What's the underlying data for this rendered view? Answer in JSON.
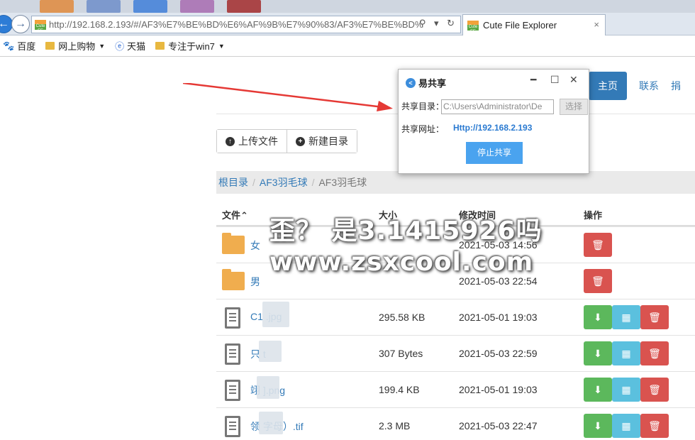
{
  "browser": {
    "url": "http://192.168.2.193/#/AF3%E7%BE%BD%E6%AF%9B%E7%90%83/AF3%E7%BE%BD%E6%",
    "tab_title": "Cute File Explorer",
    "tab_close": "×",
    "favicon_text": "Cute FE",
    "back_glyph": "←",
    "forward_glyph": "→",
    "addr_icons": "⚲ ▾ ↻",
    "bookmarks": [
      {
        "label": "百度",
        "icon": "baidu-icon"
      },
      {
        "label": "网上购物",
        "icon": "folder-icon",
        "dropdown": true
      },
      {
        "label": "天猫",
        "icon": "ie-page-icon"
      },
      {
        "label": "专注于win7",
        "icon": "folder-icon",
        "dropdown": true
      }
    ]
  },
  "nav": {
    "home": "主页",
    "contact": "联系",
    "donate": "捐"
  },
  "toolbar": {
    "upload": "上传文件",
    "new_dir": "新建目录"
  },
  "breadcrumb": {
    "root": "根目录",
    "level1": "AF3羽毛球",
    "current": "AF3羽毛球",
    "sep": "/"
  },
  "table": {
    "headers": {
      "file": "文件",
      "sort_arrow": "⌃",
      "size": "大小",
      "mtime": "修改时间",
      "ops": "操作"
    },
    "rows": [
      {
        "type": "folder",
        "name": "女",
        "size": "",
        "mtime": "2021-05-03 14:56"
      },
      {
        "type": "folder",
        "name": "男",
        "size": "",
        "mtime": "2021-05-03 22:54"
      },
      {
        "type": "file",
        "name": "C1 .jpg",
        "size": "295.58 KB",
        "mtime": "2021-05-01 19:03"
      },
      {
        "type": "file",
        "name": "只 t",
        "size": "307 Bytes",
        "mtime": "2021-05-03 22:59"
      },
      {
        "type": "file",
        "name": "翊 ].png",
        "size": "199.4 KB",
        "mtime": "2021-05-01 19:03"
      },
      {
        "type": "file",
        "name": "领 字母）.tif",
        "size": "2.3 MB",
        "mtime": "2021-05-03 22:47"
      }
    ]
  },
  "dialog": {
    "title": "易共享",
    "dir_label": "共享目录：",
    "dir_value": "C:\\Users\\Administrator\\De",
    "choose": "选择",
    "url_label": "共享网址：",
    "url_value": "Http://192.168.2.193",
    "stop": "停止共享",
    "min": "━",
    "max": "☐",
    "close": "✕"
  },
  "watermark": {
    "line1": "歪？ 是3.1415926吗",
    "line2": "www.zsxcool.com"
  },
  "colors": {
    "primary": "#337ab7",
    "success": "#5cb85c",
    "info": "#5bc0de",
    "danger": "#d9534f",
    "folder": "#f0ad4e",
    "annotation_arrow": "#e53935"
  }
}
